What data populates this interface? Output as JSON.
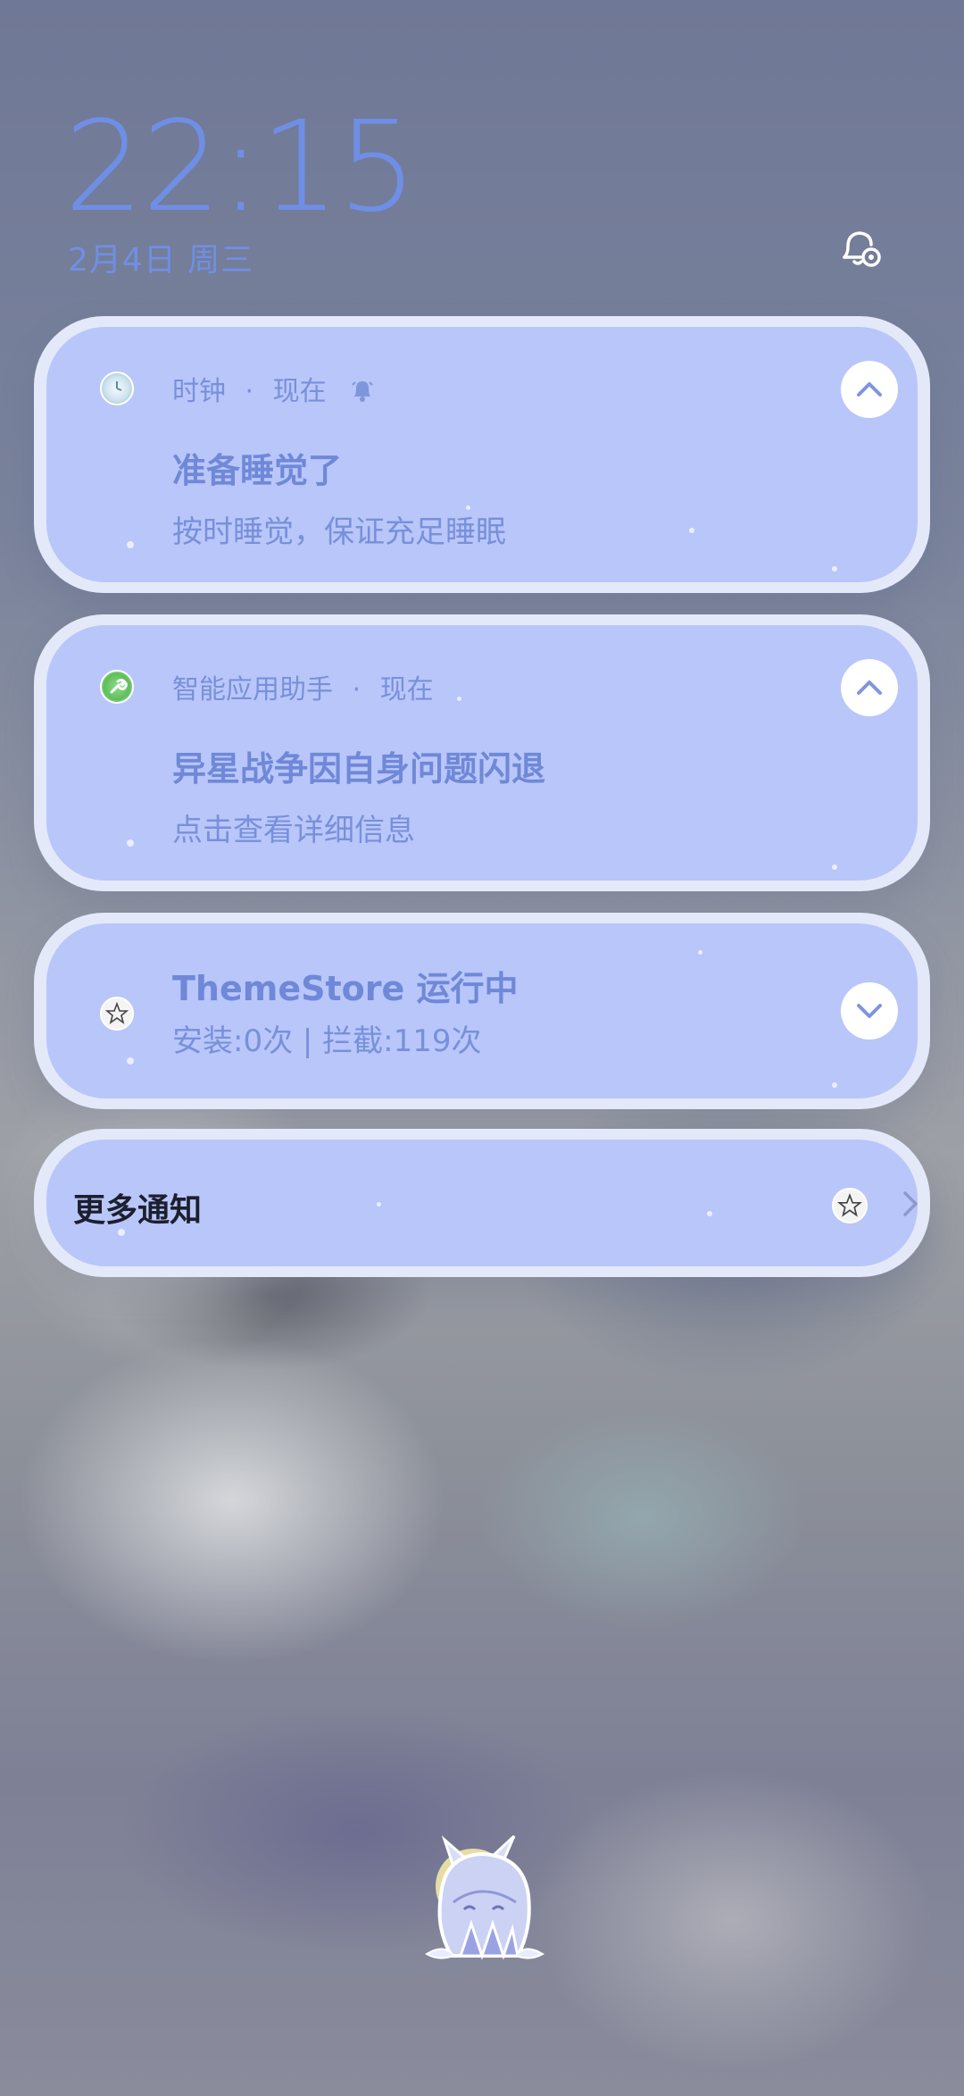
{
  "lockscreen": {
    "time": "22:15",
    "date": "2月4日 周三"
  },
  "notifications": [
    {
      "app": "时钟",
      "separator": "·",
      "when": "现在",
      "title": "准备睡觉了",
      "body": "按时睡觉，保证充足睡眠",
      "icon": "clock-app-icon",
      "extra_icon": "alarm-bell-icon",
      "toggle_icon": "chevron-up-icon"
    },
    {
      "app": "智能应用助手",
      "separator": "·",
      "when": "现在",
      "title": "异星战争因自身问题闪退",
      "body": "点击查看详细信息",
      "icon": "wrench-app-icon",
      "toggle_icon": "chevron-up-icon"
    },
    {
      "title": "ThemeStore 运行中",
      "body": "安装:0次 | 拦截:119次",
      "icon": "themestore-app-icon",
      "toggle_icon": "chevron-down-icon"
    }
  ],
  "more": {
    "label": "更多通知",
    "icon": "themestore-app-icon",
    "arrow_icon": "chevron-right-icon"
  },
  "colors": {
    "accent": "#6f8fe6",
    "card_fill": "#b9c6f9",
    "card_border": "#e4e9fa"
  }
}
